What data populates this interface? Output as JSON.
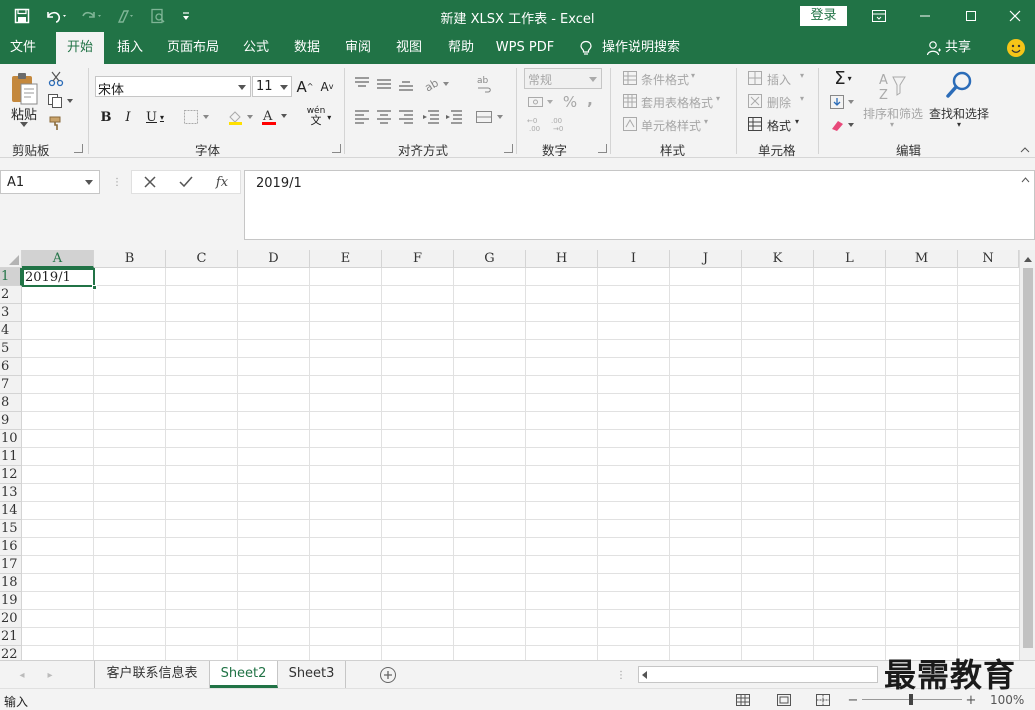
{
  "window": {
    "title": "新建 XLSX 工作表  -  Excel",
    "login_label": "登录"
  },
  "quick_access": {
    "icons": [
      "save-icon",
      "undo-icon",
      "redo-icon",
      "format-painter-icon",
      "print-preview-icon",
      "customize-icon"
    ]
  },
  "tabs": [
    {
      "label": "文件"
    },
    {
      "label": "开始",
      "active": true
    },
    {
      "label": "插入"
    },
    {
      "label": "页面布局"
    },
    {
      "label": "公式"
    },
    {
      "label": "数据"
    },
    {
      "label": "审阅"
    },
    {
      "label": "视图"
    },
    {
      "label": "帮助"
    },
    {
      "label": "WPS PDF"
    },
    {
      "label": "操作说明搜索"
    }
  ],
  "share_label": "共享",
  "ribbon": {
    "clipboard": {
      "paste_label": "粘贴",
      "group_label": "剪贴板"
    },
    "font": {
      "font_name": "宋体",
      "font_size": "11",
      "phonetic": "wén",
      "group_label": "字体"
    },
    "alignment": {
      "group_label": "对齐方式"
    },
    "number": {
      "format": "常规",
      "percent": "%",
      "comma": ",",
      "group_label": "数字"
    },
    "styles": {
      "conditional": "条件格式",
      "table": "套用表格格式",
      "cell_styles": "单元格样式",
      "group_label": "样式"
    },
    "cells": {
      "insert": "插入",
      "delete": "删除",
      "format": "格式",
      "group_label": "单元格"
    },
    "editing": {
      "sort_filter": "排序和筛选",
      "find_select": "查找和选择",
      "group_label": "编辑"
    }
  },
  "formula_bar": {
    "name_box": "A1",
    "formula": "2019/1",
    "fx": "fx"
  },
  "sheet": {
    "columns": [
      "A",
      "B",
      "C",
      "D",
      "E",
      "F",
      "G",
      "H",
      "I",
      "J",
      "K",
      "L",
      "M",
      "N"
    ],
    "rows": [
      "1",
      "2",
      "3",
      "4",
      "5",
      "6",
      "7",
      "8",
      "9",
      "10",
      "11",
      "12",
      "13",
      "14",
      "15",
      "16",
      "17",
      "18",
      "19",
      "20",
      "21",
      "22"
    ],
    "selected_cell": "A1",
    "cells": {
      "A1": "2019/1"
    }
  },
  "sheet_tabs": [
    {
      "label": "客户联系信息表"
    },
    {
      "label": "Sheet2",
      "active": true
    },
    {
      "label": "Sheet3"
    }
  ],
  "status": {
    "mode": "输入",
    "zoom": "100%"
  },
  "watermark": "最需教育",
  "colors": {
    "accent": "#217346",
    "ribbon_bg": "#f3f3f3",
    "font_color_underline": "#ff0000"
  }
}
